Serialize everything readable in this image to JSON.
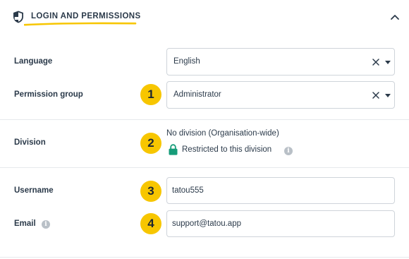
{
  "section": {
    "title": "LOGIN AND PERMISSIONS"
  },
  "icons": {
    "section": "shield-icon",
    "collapse": "chevron-up-icon",
    "clear": "close-icon",
    "dropdown": "caret-down-icon",
    "lock": "lock-icon",
    "info": "info-icon"
  },
  "colors": {
    "accent_yellow": "#f7c600",
    "lock_green": "#169c79",
    "text": "#2b3a4a",
    "border": "#cfd4da",
    "info_grey": "#b9c0c7"
  },
  "fields": {
    "language": {
      "label": "Language",
      "value": "English"
    },
    "permission_group": {
      "label": "Permission group",
      "value": "Administrator",
      "badge": "1"
    },
    "division": {
      "label": "Division",
      "value": "No division (Organisation-wide)",
      "restricted_text": "Restricted to this division",
      "badge": "2"
    },
    "username": {
      "label": "Username",
      "value": "tatou555",
      "badge": "3"
    },
    "email": {
      "label": "Email",
      "value": "support@tatou.app",
      "badge": "4"
    }
  }
}
